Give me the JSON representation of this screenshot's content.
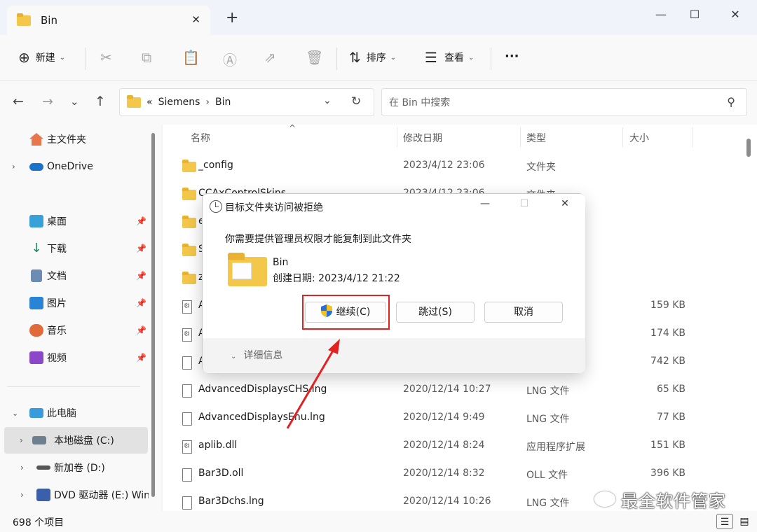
{
  "window": {
    "tab_title": "Bin",
    "tab_close": "✕",
    "new_tab": "+",
    "minimize": "—",
    "maximize": "☐",
    "close": "✕"
  },
  "toolbar": {
    "new_label": "新建",
    "sort_label": "排序",
    "view_label": "查看",
    "more": "···"
  },
  "address": {
    "prefix": "«",
    "crumb1": "Siemens",
    "crumb2": "Bin",
    "separator": "›"
  },
  "search": {
    "placeholder": "在 Bin 中搜索"
  },
  "sidebar": {
    "items": [
      {
        "label": "主文件夹",
        "icon": "home-icon"
      },
      {
        "label": "OneDrive",
        "icon": "onedrive-icon"
      },
      {
        "label": "桌面",
        "icon": "desktop-icon"
      },
      {
        "label": "下载",
        "icon": "download-icon"
      },
      {
        "label": "文档",
        "icon": "documents-icon"
      },
      {
        "label": "图片",
        "icon": "pictures-icon"
      },
      {
        "label": "音乐",
        "icon": "music-icon"
      },
      {
        "label": "视频",
        "icon": "videos-icon"
      },
      {
        "label": "此电脑",
        "icon": "computer-icon"
      },
      {
        "label": "本地磁盘 (C:)",
        "icon": "drive-icon"
      },
      {
        "label": "新加卷 (D:)",
        "icon": "drive-icon"
      },
      {
        "label": "DVD 驱动器 (E:) Win",
        "icon": "dvd-icon"
      }
    ]
  },
  "columns": {
    "name": "名称",
    "date": "修改日期",
    "type": "类型",
    "size": "大小"
  },
  "files": [
    {
      "name": "_config",
      "date": "2023/4/12 23:06",
      "type": "文件夹",
      "size": "",
      "icon": "folder"
    },
    {
      "name": "CCAxControlSkins",
      "date": "2023/4/12 23:06",
      "type": "文件夹",
      "size": "",
      "icon": "folder"
    },
    {
      "name": "e",
      "date": "",
      "type": "",
      "size": "",
      "icon": "folder"
    },
    {
      "name": "S",
      "date": "",
      "type": "",
      "size": "",
      "icon": "folder"
    },
    {
      "name": "z",
      "date": "",
      "type": "",
      "size": "",
      "icon": "folder"
    },
    {
      "name": "A",
      "date": "",
      "type": "",
      "size": "159 KB",
      "icon": "dll"
    },
    {
      "name": "A",
      "date": "",
      "type": "",
      "size": "174 KB",
      "icon": "dll"
    },
    {
      "name": "A",
      "date": "",
      "type": "",
      "size": "742 KB",
      "icon": "doc"
    },
    {
      "name": "AdvancedDisplaysCHS.lng",
      "date": "2020/12/14 10:27",
      "type": "LNG 文件",
      "size": "65 KB",
      "icon": "doc"
    },
    {
      "name": "AdvancedDisplaysEnu.lng",
      "date": "2020/12/14 9:49",
      "type": "LNG 文件",
      "size": "77 KB",
      "icon": "doc"
    },
    {
      "name": "aplib.dll",
      "date": "2020/12/14 8:24",
      "type": "应用程序扩展",
      "size": "151 KB",
      "icon": "dll"
    },
    {
      "name": "Bar3D.oll",
      "date": "2020/12/14 8:32",
      "type": "OLL 文件",
      "size": "396 KB",
      "icon": "doc"
    },
    {
      "name": "Bar3Dchs.lng",
      "date": "2020/12/14 10:26",
      "type": "LNG 文件",
      "size": "",
      "icon": "doc"
    }
  ],
  "status": {
    "item_count": "698 个项目"
  },
  "dialog": {
    "title": "目标文件夹访问被拒绝",
    "message": "你需要提供管理员权限才能复制到此文件夹",
    "folder_name": "Bin",
    "created": "创建日期: 2023/4/12 21:22",
    "continue_label": "继续(C)",
    "skip_label": "跳过(S)",
    "cancel_label": "取消",
    "more_info": "详细信息",
    "close": "✕",
    "minimize": "—",
    "maximize": "☐"
  },
  "watermark": "最全软件管家",
  "colors": {
    "highlight": "#e12222",
    "folder": "#f3c74a",
    "selected_bg": "#e2e2e2"
  }
}
